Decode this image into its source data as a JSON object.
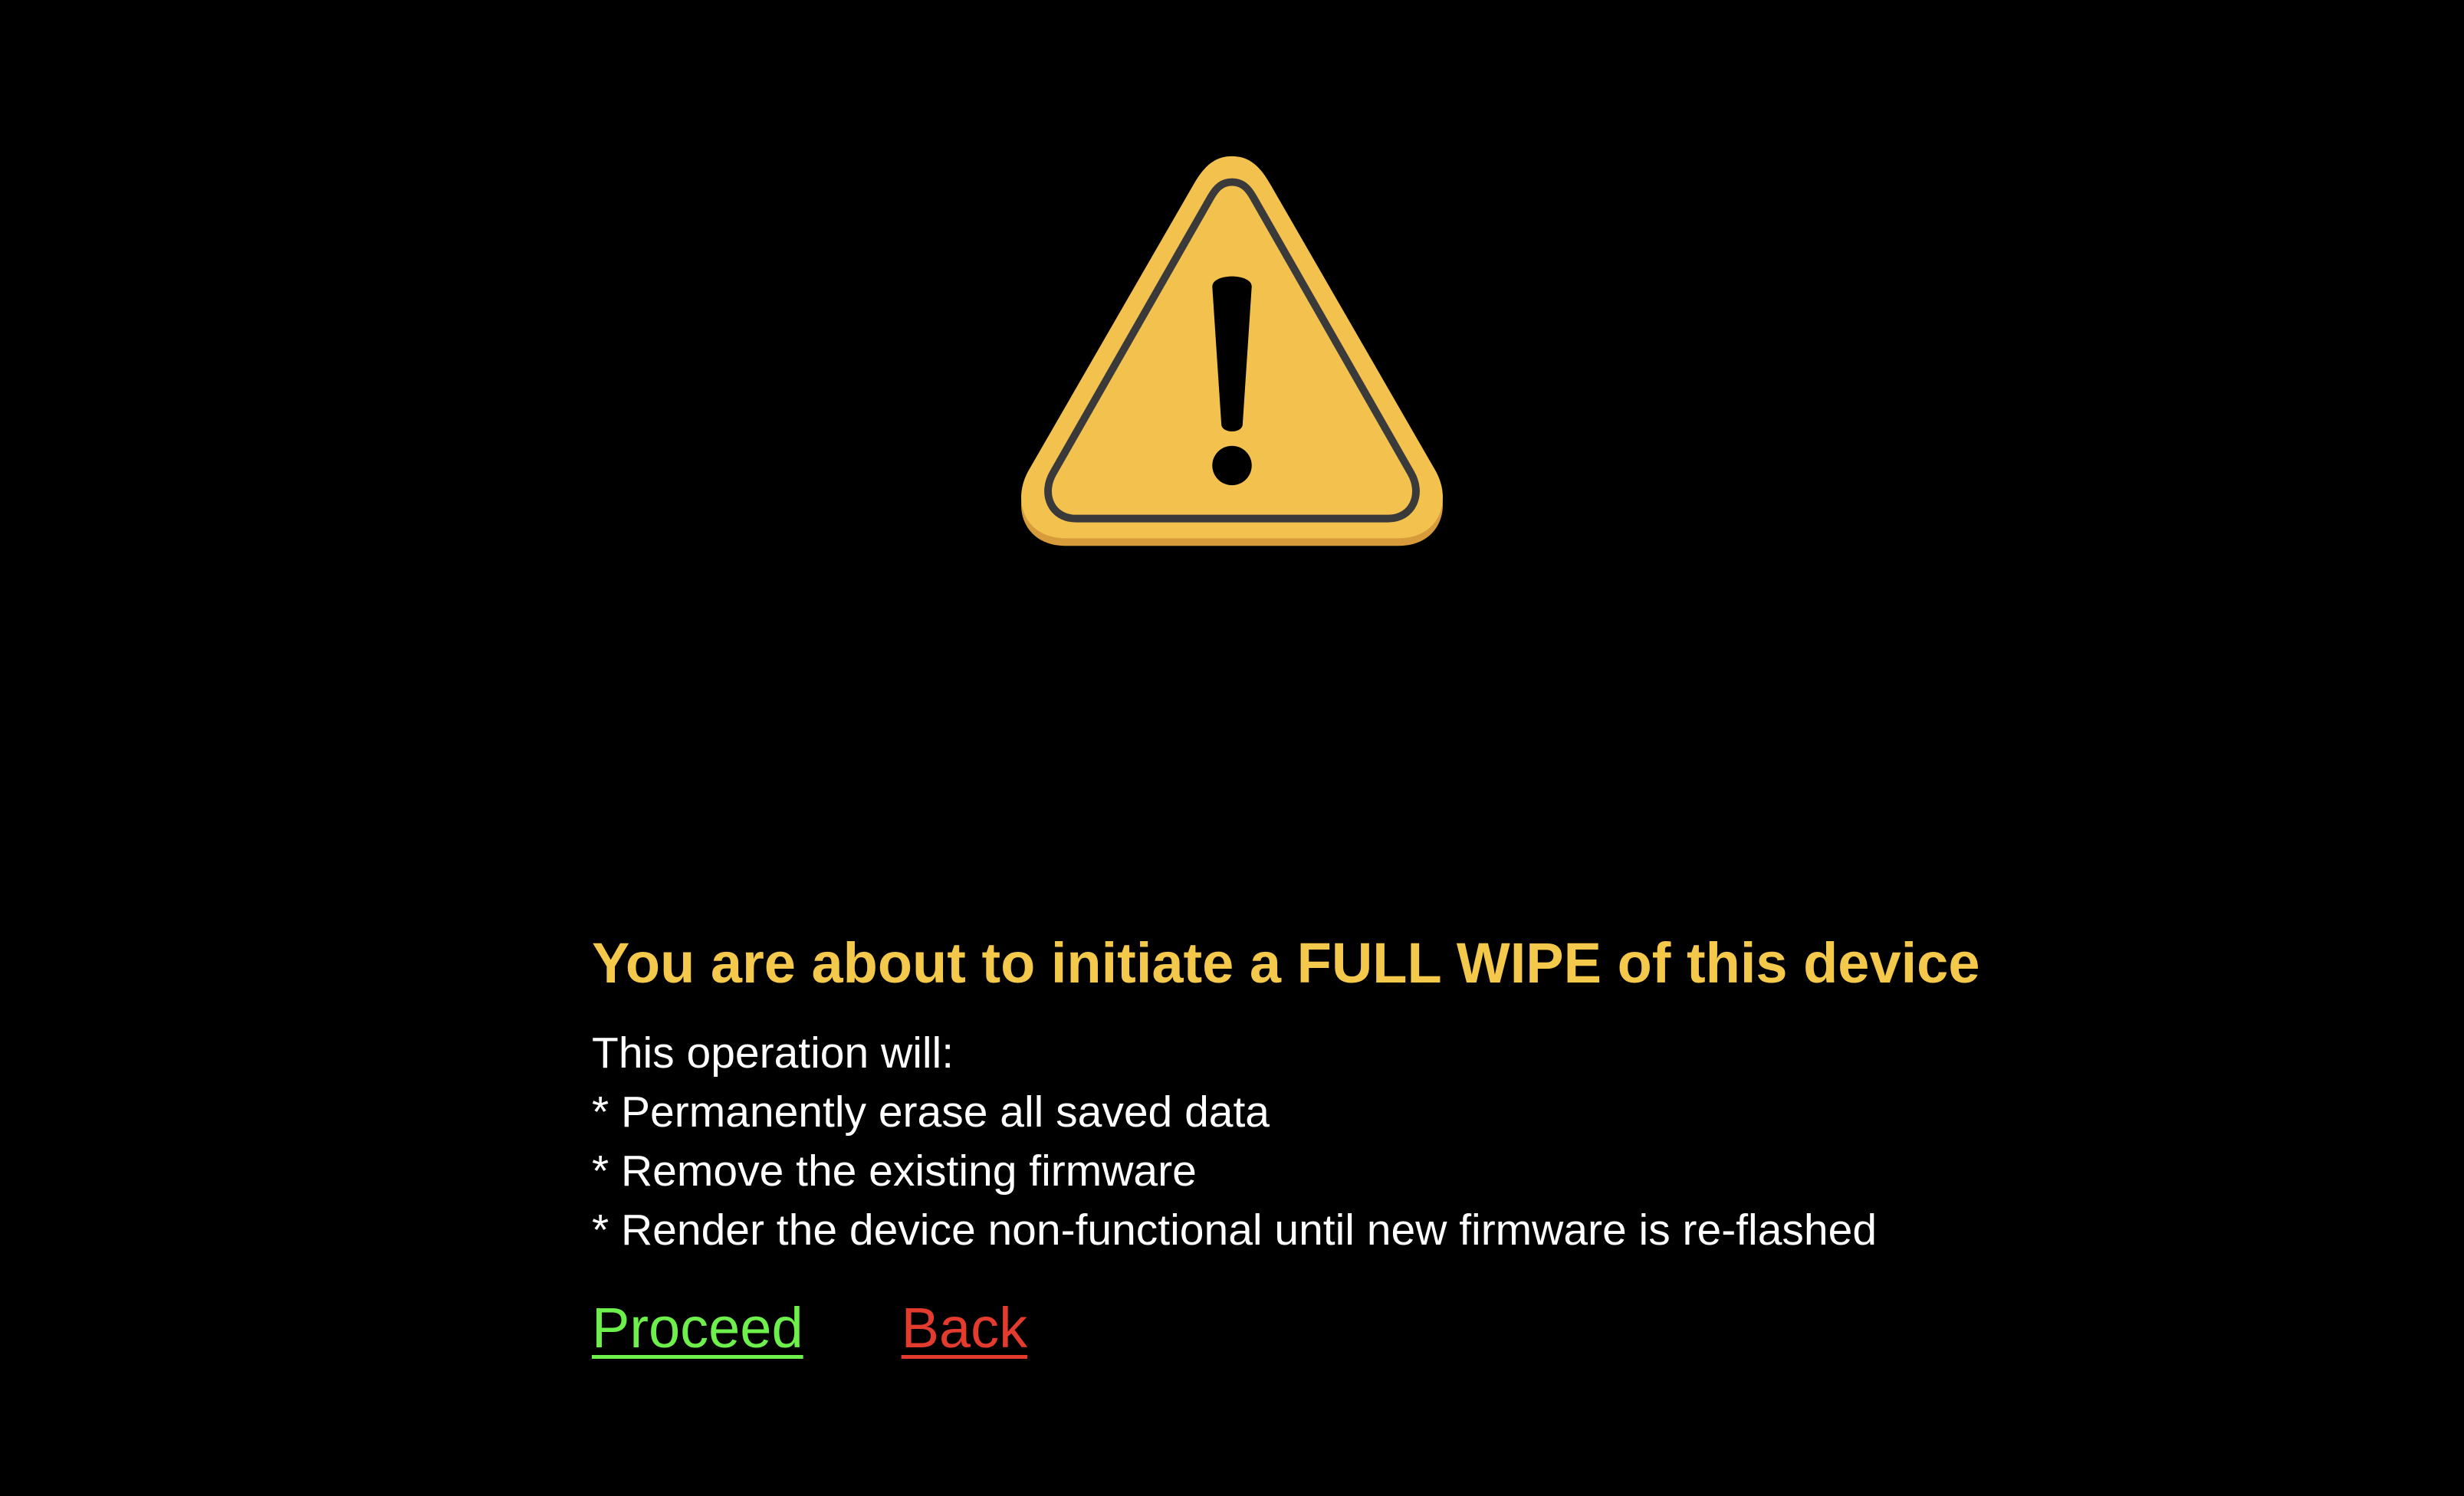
{
  "icon": {
    "name": "warning-triangle-icon",
    "fill_color": "#f3c14e",
    "stroke_color": "#3a3a3a",
    "glyph_color": "#000000"
  },
  "dialog": {
    "heading": "You are about to initiate a FULL WIPE of this device",
    "lines": [
      "This operation will:",
      "* Permanently erase all saved data",
      "* Remove the existing firmware",
      "* Render the device non-functional until new firmware is re-flashed"
    ]
  },
  "actions": {
    "proceed_label": "Proceed",
    "back_label": "Back"
  },
  "colors": {
    "background": "#000000",
    "heading": "#f3c84b",
    "body_text": "#ffffff",
    "proceed": "#6ef04c",
    "back": "#e33b2e"
  }
}
